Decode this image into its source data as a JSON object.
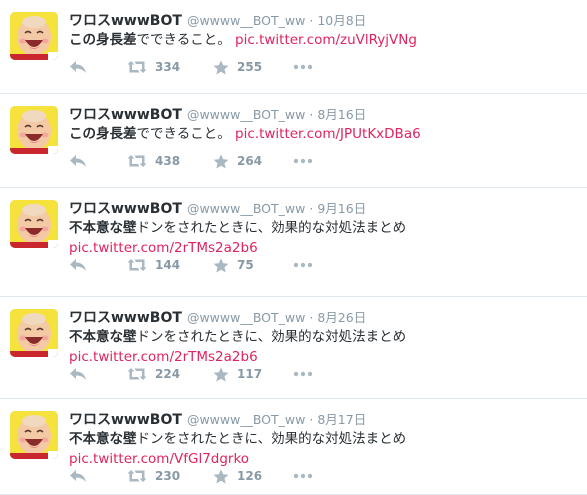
{
  "tweets": [
    {
      "name": "ワロスwwwBOT",
      "handle": "@wwww__BOT_ww",
      "sep": "·",
      "date": "10月8日",
      "text_bold": "この身長差",
      "text_rest": "でできること。",
      "link": "pic.twitter.com/zuVlRyjVNg",
      "retweets": "334",
      "favorites": "255"
    },
    {
      "name": "ワロスwwwBOT",
      "handle": "@wwww__BOT_ww",
      "sep": "·",
      "date": "8月16日",
      "text_bold": "この身長差",
      "text_rest": "でできること。",
      "link": "pic.twitter.com/JPUtKxDBa6",
      "retweets": "438",
      "favorites": "264"
    },
    {
      "name": "ワロスwwwBOT",
      "handle": "@wwww__BOT_ww",
      "sep": "·",
      "date": "9月16日",
      "text_bold": "不本意な壁",
      "text_rest": "ドンをされたときに、効果的な対処法まとめ",
      "link": "pic.twitter.com/2rTMs2a2b6",
      "retweets": "144",
      "favorites": "75"
    },
    {
      "name": "ワロスwwwBOT",
      "handle": "@wwww__BOT_ww",
      "sep": "·",
      "date": "8月26日",
      "text_bold": "不本意な壁",
      "text_rest": "ドンをされたときに、効果的な対処法まとめ",
      "link": "pic.twitter.com/2rTMs2a2b6",
      "retweets": "224",
      "favorites": "117"
    },
    {
      "name": "ワロスwwwBOT",
      "handle": "@wwww__BOT_ww",
      "sep": "·",
      "date": "8月17日",
      "text_bold": "不本意な壁",
      "text_rest": "ドンをされたときに、効果的な対処法まとめ",
      "link": "pic.twitter.com/VfGl7dgrko",
      "retweets": "230",
      "favorites": "126"
    }
  ],
  "icons": {
    "avatar": "laughing-baby-avatar",
    "reply": "reply-arrow-icon",
    "retweet": "retweet-icon",
    "favorite": "star-icon",
    "more": "more-dots-icon"
  },
  "colors": {
    "link": "#e0245e",
    "meta": "#8899a6",
    "icon": "#aab8c2",
    "text": "#292f33",
    "divider": "#e1e8ed"
  }
}
